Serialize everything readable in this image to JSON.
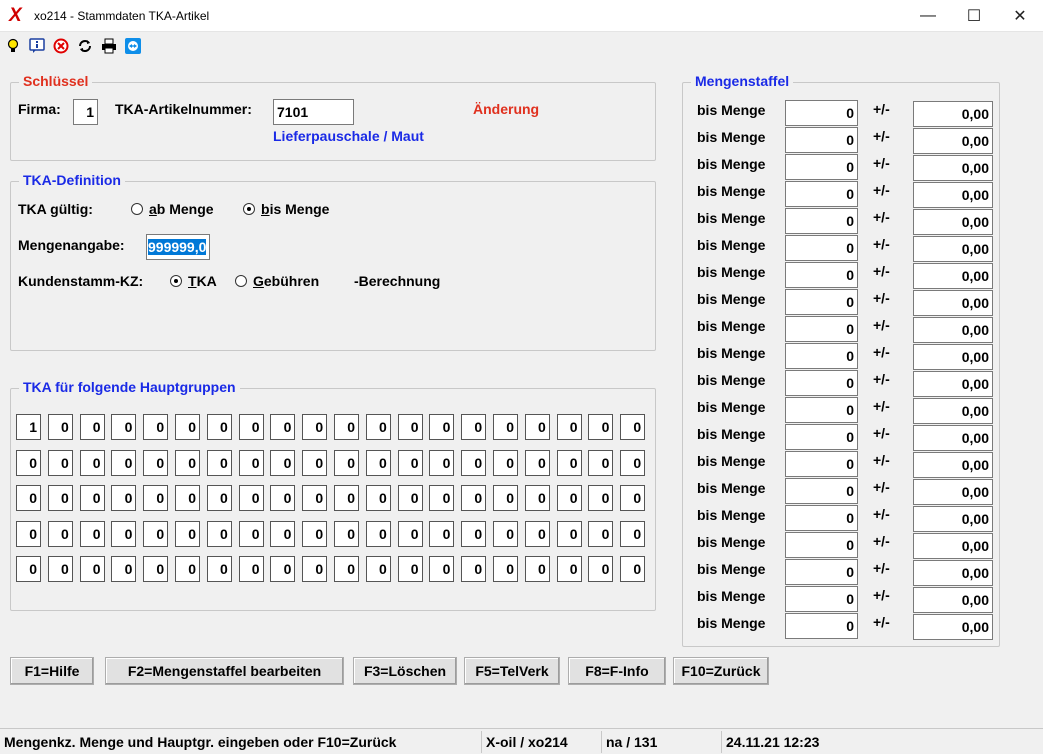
{
  "window": {
    "title": "xo214 - Stammdaten TKA-Artikel",
    "logo": "X",
    "minimize": "—",
    "maximize": "☐",
    "close": "✕"
  },
  "toolbar": {
    "icons": [
      "lightbulb-icon",
      "info-chat-icon",
      "stop-icon",
      "refresh-icon",
      "printer-icon",
      "teamviewer-icon"
    ]
  },
  "schluessel": {
    "legend": "Schlüssel",
    "firma_label": "Firma:",
    "firma_value": "1",
    "artikel_label": "TKA-Artikelnummer:",
    "artikel_value": "7101",
    "mode": "Änderung",
    "artikel_name": "Lieferpauschale / Maut"
  },
  "definition": {
    "legend": "TKA-Definition",
    "gueltig_label": "TKA gültig:",
    "ab_menge_ul": "a",
    "ab_menge_rest": "b Menge",
    "bis_menge_ul": "b",
    "bis_menge_rest": "is Menge",
    "gueltig_selected": "bis Menge",
    "mengenangabe_label": "Mengenangabe:",
    "mengenangabe_value": "999999,0",
    "kundenstamm_label": "Kundenstamm-KZ:",
    "tka_ul": "T",
    "tka_rest": "KA",
    "gebuehren_ul": "G",
    "gebuehren_rest": "ebühren",
    "berechnung": "-Berechnung",
    "kundenstamm_selected": "TKA"
  },
  "hauptgruppen": {
    "legend": "TKA für folgende Hauptgruppen",
    "rows": [
      [
        "1",
        "0",
        "0",
        "0",
        "0",
        "0",
        "0",
        "0",
        "0",
        "0",
        "0",
        "0",
        "0",
        "0",
        "0",
        "0",
        "0",
        "0",
        "0",
        "0"
      ],
      [
        "0",
        "0",
        "0",
        "0",
        "0",
        "0",
        "0",
        "0",
        "0",
        "0",
        "0",
        "0",
        "0",
        "0",
        "0",
        "0",
        "0",
        "0",
        "0",
        "0"
      ],
      [
        "0",
        "0",
        "0",
        "0",
        "0",
        "0",
        "0",
        "0",
        "0",
        "0",
        "0",
        "0",
        "0",
        "0",
        "0",
        "0",
        "0",
        "0",
        "0",
        "0"
      ],
      [
        "0",
        "0",
        "0",
        "0",
        "0",
        "0",
        "0",
        "0",
        "0",
        "0",
        "0",
        "0",
        "0",
        "0",
        "0",
        "0",
        "0",
        "0",
        "0",
        "0"
      ],
      [
        "0",
        "0",
        "0",
        "0",
        "0",
        "0",
        "0",
        "0",
        "0",
        "0",
        "0",
        "0",
        "0",
        "0",
        "0",
        "0",
        "0",
        "0",
        "0",
        "0"
      ]
    ]
  },
  "mengenstaffel": {
    "legend": "Mengenstaffel",
    "row_label": "bis Menge",
    "plusminus": "+/-",
    "rows": [
      {
        "menge": "0",
        "betrag": "0,00"
      },
      {
        "menge": "0",
        "betrag": "0,00"
      },
      {
        "menge": "0",
        "betrag": "0,00"
      },
      {
        "menge": "0",
        "betrag": "0,00"
      },
      {
        "menge": "0",
        "betrag": "0,00"
      },
      {
        "menge": "0",
        "betrag": "0,00"
      },
      {
        "menge": "0",
        "betrag": "0,00"
      },
      {
        "menge": "0",
        "betrag": "0,00"
      },
      {
        "menge": "0",
        "betrag": "0,00"
      },
      {
        "menge": "0",
        "betrag": "0,00"
      },
      {
        "menge": "0",
        "betrag": "0,00"
      },
      {
        "menge": "0",
        "betrag": "0,00"
      },
      {
        "menge": "0",
        "betrag": "0,00"
      },
      {
        "menge": "0",
        "betrag": "0,00"
      },
      {
        "menge": "0",
        "betrag": "0,00"
      },
      {
        "menge": "0",
        "betrag": "0,00"
      },
      {
        "menge": "0",
        "betrag": "0,00"
      },
      {
        "menge": "0",
        "betrag": "0,00"
      },
      {
        "menge": "0",
        "betrag": "0,00"
      },
      {
        "menge": "0",
        "betrag": "0,00"
      }
    ]
  },
  "buttons": {
    "f1": "F1=Hilfe",
    "f2": "F2=Mengenstaffel bearbeiten",
    "f3": "F3=Löschen",
    "f5": "F5=TelVerk",
    "f8": "F8=F-Info",
    "f10": "F10=Zurück"
  },
  "status": {
    "message": "Mengenkz. Menge und Hauptgr. eingeben oder F10=Zurück",
    "app": "X-oil / xo214",
    "user": "na / 131",
    "datetime": "24.11.21 12:23"
  },
  "colors": {
    "red_accent": "#e0301e",
    "blue_accent": "#1a2ae6",
    "selection": "#0078d7"
  }
}
